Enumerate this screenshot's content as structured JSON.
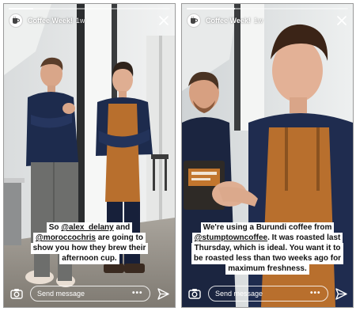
{
  "stories": [
    {
      "account": "Coffee Week!",
      "age": "1w",
      "progress": 0.15,
      "caption_lines": [
        [
          {
            "text": "So "
          },
          {
            "text": "@alex_delany",
            "mention": true
          },
          {
            "text": " and"
          }
        ],
        [
          {
            "text": "@moroccochris",
            "mention": true
          },
          {
            "text": " are going to"
          }
        ],
        [
          {
            "text": "show you how they brew their"
          }
        ],
        [
          {
            "text": "afternoon cup."
          }
        ]
      ],
      "message_placeholder": "Send message",
      "more_label": "•••"
    },
    {
      "account": "Coffee Week!",
      "age": "1w",
      "progress": 0.3,
      "caption_lines": [
        [
          {
            "text": "We're using a Burundi coffee from"
          }
        ],
        [
          {
            "text": "@stumptowncoffee",
            "mention": true
          },
          {
            "text": ". It was roasted last"
          }
        ],
        [
          {
            "text": "Thursday, which is ideal. You want it to"
          }
        ],
        [
          {
            "text": "be roasted less than two weeks ago for"
          }
        ],
        [
          {
            "text": "maximum freshness."
          }
        ]
      ],
      "message_placeholder": "Send message",
      "more_label": "•••"
    }
  ],
  "colors": {
    "apron": "#b86f2d",
    "shirt": "#1f2c4f",
    "caption_bg": "#ffffff"
  },
  "icons": {
    "avatar": "coffee-cup-logo-icon",
    "close": "close-icon",
    "camera": "camera-icon",
    "more": "more-options-icon",
    "send": "send-direct-icon"
  }
}
